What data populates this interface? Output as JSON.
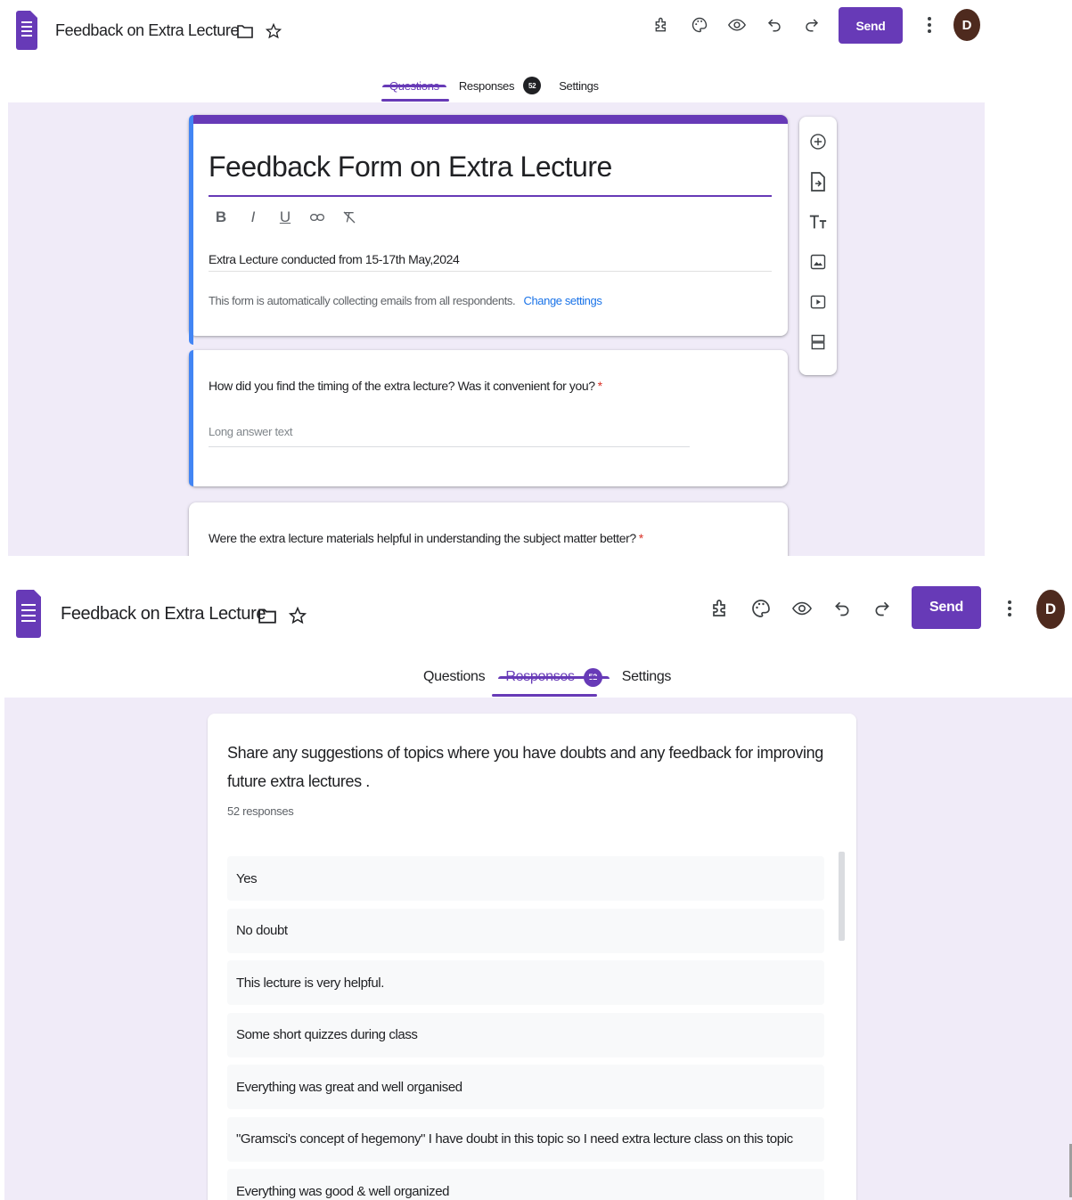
{
  "app": {
    "doc_title": "Feedback on Extra Lecture",
    "send_label": "Send",
    "avatar_letter": "D",
    "tabs": {
      "questions": "Questions",
      "responses": "Responses",
      "responses_badge": "52",
      "settings": "Settings"
    }
  },
  "editor": {
    "form_title": "Feedback Form on Extra Lecture",
    "format_buttons": [
      "B",
      "I",
      "U"
    ],
    "description": "Extra Lecture conducted from 15-17th May,2024",
    "auto_collect_note": "This form is automatically collecting emails from all respondents.",
    "change_settings_link": "Change settings",
    "questions": [
      {
        "text": "How did you find the timing of the extra lecture? Was it convenient for you?",
        "required_mark": "*",
        "answer_placeholder": "Long answer text"
      },
      {
        "text": "Were the extra lecture materials helpful in understanding the subject matter better?",
        "required_mark": "*"
      }
    ]
  },
  "responses_view": {
    "question": "Share any suggestions of topics where you have doubts and  any feedback for improving future extra lectures .",
    "count_label": "52 responses",
    "items": [
      "Yes",
      "No doubt",
      "This lecture is very helpful.",
      "Some short quizzes during class",
      "Everything was great and well organised",
      "\"Gramsci's concept of hegemony\" I have doubt in this topic so I need extra lecture class on this topic",
      "Everything was good & well organized"
    ]
  },
  "icons": {
    "header": [
      "add-on-icon",
      "palette-icon",
      "preview-icon",
      "undo-icon",
      "redo-icon",
      "more-vert-icon",
      "folder-icon",
      "star-icon"
    ],
    "side_toolbar": [
      "add-question-icon",
      "import-questions-icon",
      "add-title-icon",
      "add-image-icon",
      "add-video-icon",
      "add-section-icon"
    ]
  },
  "colors": {
    "accent": "#673ab7",
    "background": "#f0ebf8",
    "selected_border": "#4285f4",
    "required": "#d93025",
    "link": "#1a73e8"
  }
}
